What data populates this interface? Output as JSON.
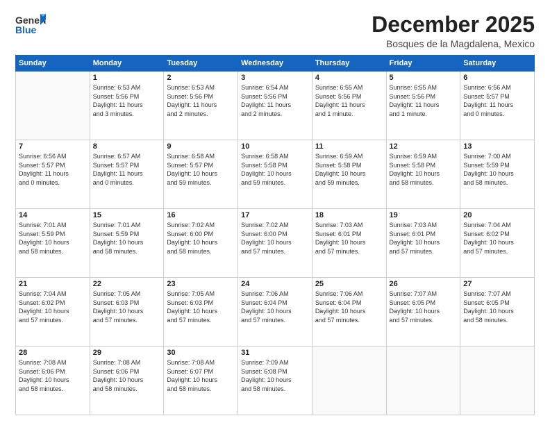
{
  "header": {
    "logo_general": "General",
    "logo_blue": "Blue",
    "title": "December 2025",
    "location": "Bosques de la Magdalena, Mexico"
  },
  "weekdays": [
    "Sunday",
    "Monday",
    "Tuesday",
    "Wednesday",
    "Thursday",
    "Friday",
    "Saturday"
  ],
  "weeks": [
    [
      {
        "day": "",
        "info": ""
      },
      {
        "day": "1",
        "info": "Sunrise: 6:53 AM\nSunset: 5:56 PM\nDaylight: 11 hours\nand 3 minutes."
      },
      {
        "day": "2",
        "info": "Sunrise: 6:53 AM\nSunset: 5:56 PM\nDaylight: 11 hours\nand 2 minutes."
      },
      {
        "day": "3",
        "info": "Sunrise: 6:54 AM\nSunset: 5:56 PM\nDaylight: 11 hours\nand 2 minutes."
      },
      {
        "day": "4",
        "info": "Sunrise: 6:55 AM\nSunset: 5:56 PM\nDaylight: 11 hours\nand 1 minute."
      },
      {
        "day": "5",
        "info": "Sunrise: 6:55 AM\nSunset: 5:56 PM\nDaylight: 11 hours\nand 1 minute."
      },
      {
        "day": "6",
        "info": "Sunrise: 6:56 AM\nSunset: 5:57 PM\nDaylight: 11 hours\nand 0 minutes."
      }
    ],
    [
      {
        "day": "7",
        "info": "Sunrise: 6:56 AM\nSunset: 5:57 PM\nDaylight: 11 hours\nand 0 minutes."
      },
      {
        "day": "8",
        "info": "Sunrise: 6:57 AM\nSunset: 5:57 PM\nDaylight: 11 hours\nand 0 minutes."
      },
      {
        "day": "9",
        "info": "Sunrise: 6:58 AM\nSunset: 5:57 PM\nDaylight: 10 hours\nand 59 minutes."
      },
      {
        "day": "10",
        "info": "Sunrise: 6:58 AM\nSunset: 5:58 PM\nDaylight: 10 hours\nand 59 minutes."
      },
      {
        "day": "11",
        "info": "Sunrise: 6:59 AM\nSunset: 5:58 PM\nDaylight: 10 hours\nand 59 minutes."
      },
      {
        "day": "12",
        "info": "Sunrise: 6:59 AM\nSunset: 5:58 PM\nDaylight: 10 hours\nand 58 minutes."
      },
      {
        "day": "13",
        "info": "Sunrise: 7:00 AM\nSunset: 5:59 PM\nDaylight: 10 hours\nand 58 minutes."
      }
    ],
    [
      {
        "day": "14",
        "info": "Sunrise: 7:01 AM\nSunset: 5:59 PM\nDaylight: 10 hours\nand 58 minutes."
      },
      {
        "day": "15",
        "info": "Sunrise: 7:01 AM\nSunset: 5:59 PM\nDaylight: 10 hours\nand 58 minutes."
      },
      {
        "day": "16",
        "info": "Sunrise: 7:02 AM\nSunset: 6:00 PM\nDaylight: 10 hours\nand 58 minutes."
      },
      {
        "day": "17",
        "info": "Sunrise: 7:02 AM\nSunset: 6:00 PM\nDaylight: 10 hours\nand 57 minutes."
      },
      {
        "day": "18",
        "info": "Sunrise: 7:03 AM\nSunset: 6:01 PM\nDaylight: 10 hours\nand 57 minutes."
      },
      {
        "day": "19",
        "info": "Sunrise: 7:03 AM\nSunset: 6:01 PM\nDaylight: 10 hours\nand 57 minutes."
      },
      {
        "day": "20",
        "info": "Sunrise: 7:04 AM\nSunset: 6:02 PM\nDaylight: 10 hours\nand 57 minutes."
      }
    ],
    [
      {
        "day": "21",
        "info": "Sunrise: 7:04 AM\nSunset: 6:02 PM\nDaylight: 10 hours\nand 57 minutes."
      },
      {
        "day": "22",
        "info": "Sunrise: 7:05 AM\nSunset: 6:03 PM\nDaylight: 10 hours\nand 57 minutes."
      },
      {
        "day": "23",
        "info": "Sunrise: 7:05 AM\nSunset: 6:03 PM\nDaylight: 10 hours\nand 57 minutes."
      },
      {
        "day": "24",
        "info": "Sunrise: 7:06 AM\nSunset: 6:04 PM\nDaylight: 10 hours\nand 57 minutes."
      },
      {
        "day": "25",
        "info": "Sunrise: 7:06 AM\nSunset: 6:04 PM\nDaylight: 10 hours\nand 57 minutes."
      },
      {
        "day": "26",
        "info": "Sunrise: 7:07 AM\nSunset: 6:05 PM\nDaylight: 10 hours\nand 57 minutes."
      },
      {
        "day": "27",
        "info": "Sunrise: 7:07 AM\nSunset: 6:05 PM\nDaylight: 10 hours\nand 58 minutes."
      }
    ],
    [
      {
        "day": "28",
        "info": "Sunrise: 7:08 AM\nSunset: 6:06 PM\nDaylight: 10 hours\nand 58 minutes."
      },
      {
        "day": "29",
        "info": "Sunrise: 7:08 AM\nSunset: 6:06 PM\nDaylight: 10 hours\nand 58 minutes."
      },
      {
        "day": "30",
        "info": "Sunrise: 7:08 AM\nSunset: 6:07 PM\nDaylight: 10 hours\nand 58 minutes."
      },
      {
        "day": "31",
        "info": "Sunrise: 7:09 AM\nSunset: 6:08 PM\nDaylight: 10 hours\nand 58 minutes."
      },
      {
        "day": "",
        "info": ""
      },
      {
        "day": "",
        "info": ""
      },
      {
        "day": "",
        "info": ""
      }
    ]
  ]
}
